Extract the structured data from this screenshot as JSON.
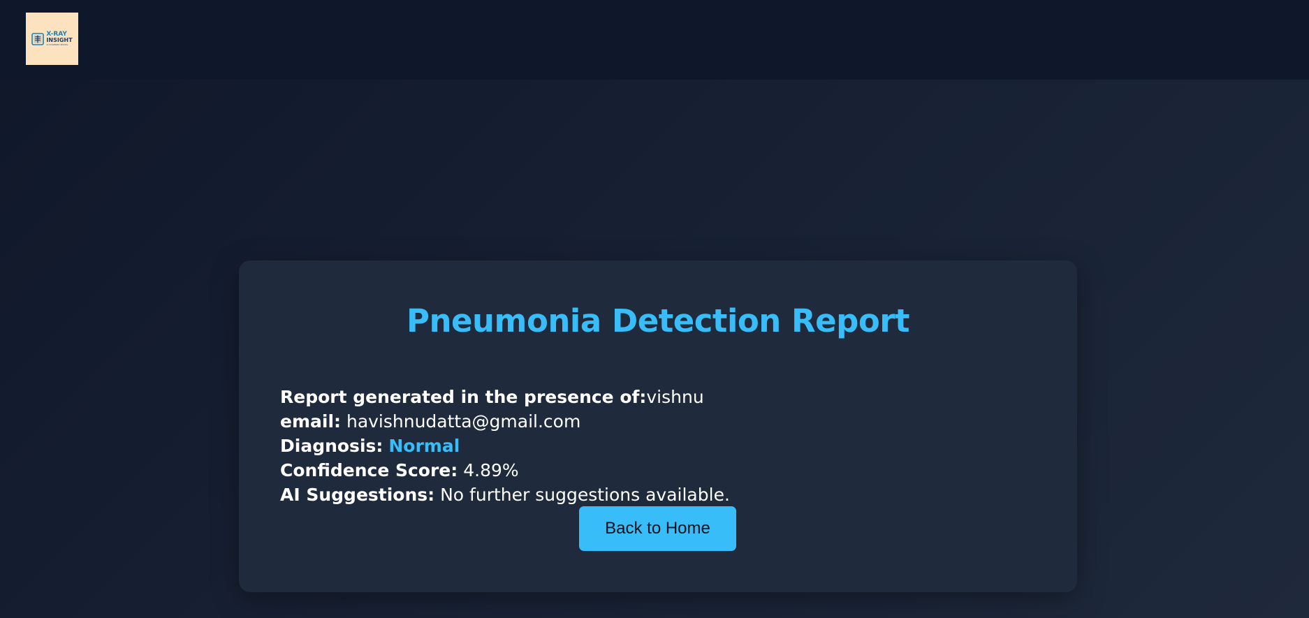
{
  "header": {
    "logo": {
      "line1": "X-RAY",
      "line2": "INSIGHT",
      "tagline": "AI POWERED MODEL",
      "icon": "xray-chest-icon"
    }
  },
  "report": {
    "title": "Pneumonia Detection Report",
    "presence_label": "Report generated in the presence of:",
    "presence_value": "vishnu",
    "email_label": "email:",
    "email_value": "havishnudatta@gmail.com",
    "diagnosis_label": "Diagnosis:",
    "diagnosis_value": "Normal",
    "confidence_label": "Confidence Score:",
    "confidence_value": "4.89%",
    "suggestions_label": "AI Suggestions:",
    "suggestions_value": "No further suggestions available."
  },
  "actions": {
    "back_home_label": "Back to Home"
  },
  "colors": {
    "accent": "#38bdf8",
    "card": "#1f2a3d",
    "header": "#0f172a",
    "logo_bg": "#fde2bf"
  }
}
